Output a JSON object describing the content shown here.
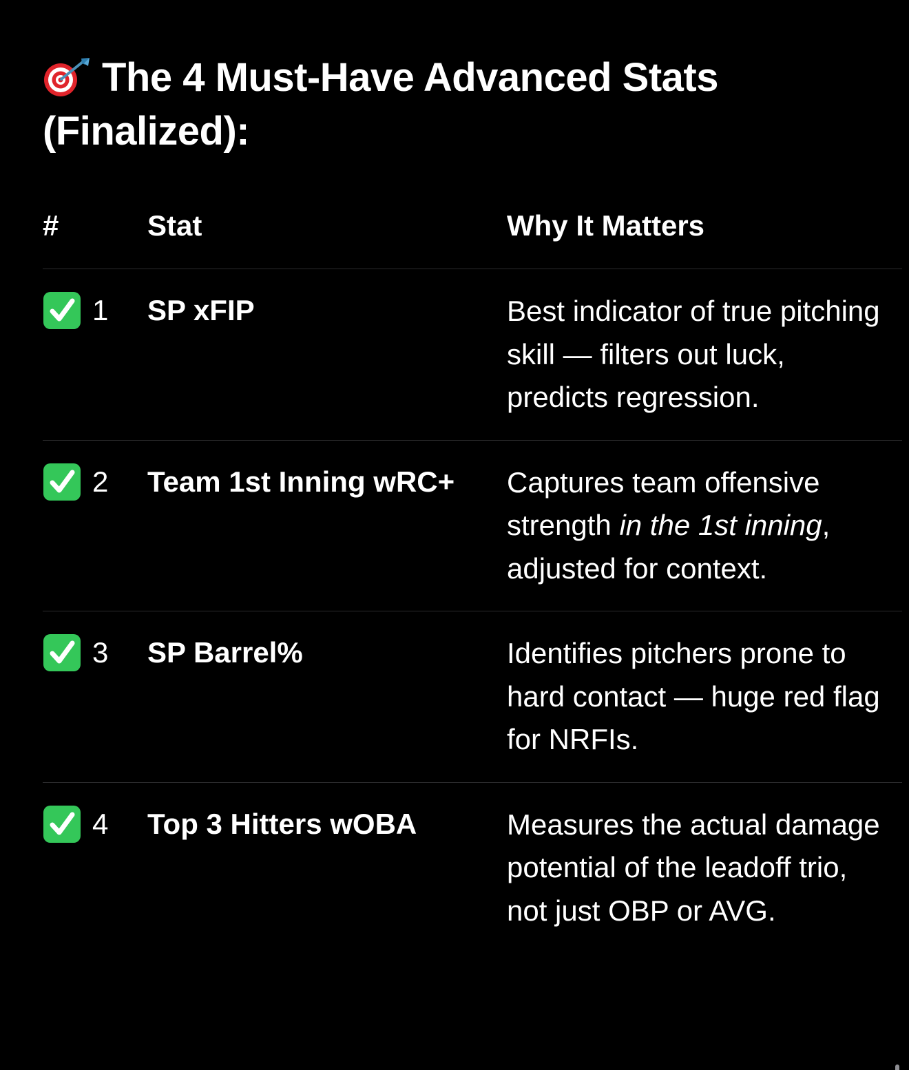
{
  "heading": {
    "icon": "direct-hit-icon",
    "text": "The 4 Must-Have Advanced Stats (Finalized):"
  },
  "table": {
    "headers": {
      "num": "#",
      "stat": "Stat",
      "why": "Why It Matters"
    },
    "check_icon": "white-check-mark-icon",
    "check_color": "#34c759",
    "rows": [
      {
        "num": "1",
        "stat": "SP xFIP",
        "why_parts": [
          "Best indicator of true pitching skill — filters out luck, predicts regression.",
          "",
          ""
        ]
      },
      {
        "num": "2",
        "stat": "Team 1st Inning wRC+",
        "why_parts": [
          "Captures team offensive strength ",
          "in the 1st inning",
          ", adjusted for context."
        ]
      },
      {
        "num": "3",
        "stat": "SP Barrel%",
        "why_parts": [
          "Identifies pitchers prone to hard contact — huge red flag for NRFIs.",
          "",
          ""
        ]
      },
      {
        "num": "4",
        "stat": "Top 3 Hitters wOBA",
        "why_parts": [
          "Measures the actual damage potential of the leadoff trio, not just OBP or AVG.",
          "",
          ""
        ]
      }
    ]
  }
}
